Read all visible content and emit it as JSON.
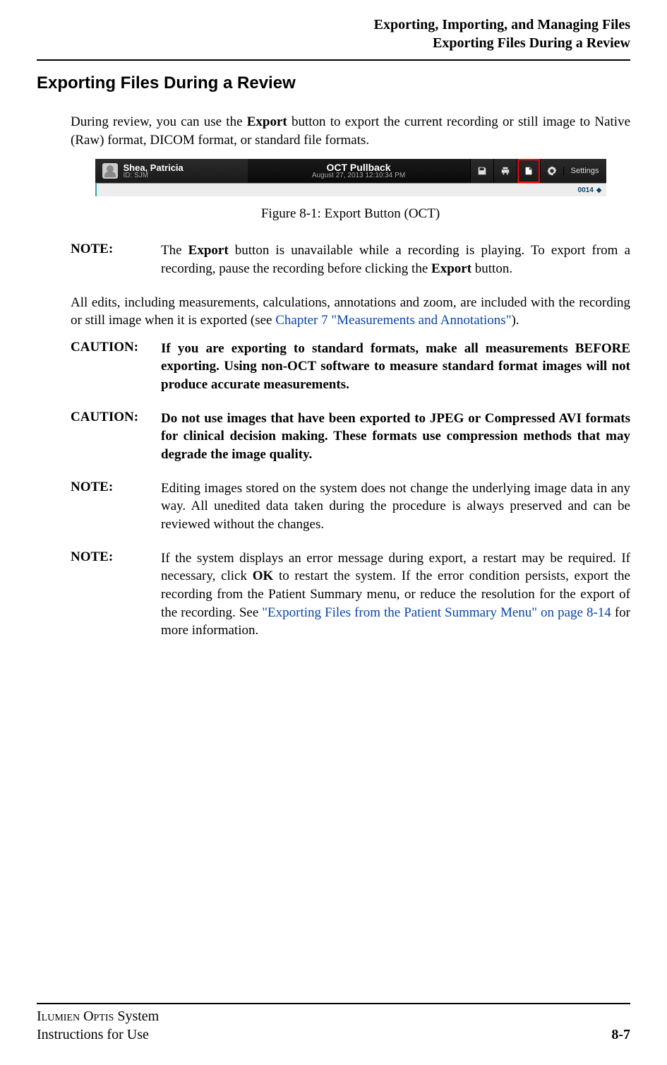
{
  "header": {
    "chapter_title": "Exporting, Importing, and Managing Files",
    "section_title": "Exporting Files During a Review"
  },
  "section_heading": "Exporting Files During a Review",
  "intro": {
    "pre_bold": "During review, you can use the ",
    "bold": "Export",
    "post_bold": " button to export the current recording or still image to Native (Raw) format, DICOM format, or standard file formats."
  },
  "figure": {
    "titlebar": {
      "patient_name": "Shea, Patricia",
      "id_label": "ID: SJM",
      "center_title": "OCT Pullback",
      "center_sub": "August 27, 2013 12:10:34 PM",
      "icons": {
        "save": "save-icon",
        "print": "print-icon",
        "export": "export-icon",
        "gear": "gear-icon"
      },
      "settings_label": "Settings",
      "frame_counter": "0014",
      "tag_glyph": "◆"
    },
    "caption": "Figure 8-1:  Export Button (OCT)"
  },
  "blocks": [
    {
      "label": "NOTE:",
      "bold_body": false,
      "runs": [
        {
          "t": "The "
        },
        {
          "t": "Export",
          "b": true
        },
        {
          "t": " button is unavailable while a recording is playing. To export from a recording, pause the recording before clicking the "
        },
        {
          "t": "Export",
          "b": true
        },
        {
          "t": " button."
        }
      ]
    }
  ],
  "edits_para": {
    "pre_link": "All edits, including measurements, calculations, annotations and zoom, are included with the recording or still image when it is exported (see ",
    "link": "Chapter 7 \"Measurements and Annotations\"",
    "post_link": ")."
  },
  "blocks2": [
    {
      "label": "CAUTION:",
      "bold_body": true,
      "runs": [
        {
          "t": "If you are exporting to standard formats, make all measurements BEFORE exporting.  Using non-OCT software to measure standard format images will not produce accurate measurements."
        }
      ]
    },
    {
      "label": "CAUTION:",
      "bold_body": true,
      "runs": [
        {
          "t": "Do not use images that have been exported to JPEG or Compressed AVI formats for clinical decision making. These formats use compression methods that may degrade the image quality."
        }
      ]
    },
    {
      "label": "NOTE:",
      "bold_body": false,
      "runs": [
        {
          "t": "Editing images stored on the system does not change the underlying image data in any way. All unedited data taken during the procedure is always preserved and can be reviewed without the changes."
        }
      ]
    },
    {
      "label": "NOTE:",
      "bold_body": false,
      "runs": [
        {
          "t": "If the system displays an error message during export, a restart may be required. If necessary, click "
        },
        {
          "t": "OK",
          "b": true
        },
        {
          "t": " to restart the system. If the error condition persists, export the recording from the Patient Summary menu, or reduce the resolution for the export of the recording. See "
        },
        {
          "t": "\"Exporting Files from the Patient Summary Menu\" on page 8-14",
          "link": true
        },
        {
          "t": " for more information."
        }
      ]
    }
  ],
  "footer": {
    "product_sc": "Ilumien Optis",
    "product_rest": " System",
    "subtitle": "Instructions for Use",
    "pagenum": "8-7"
  }
}
